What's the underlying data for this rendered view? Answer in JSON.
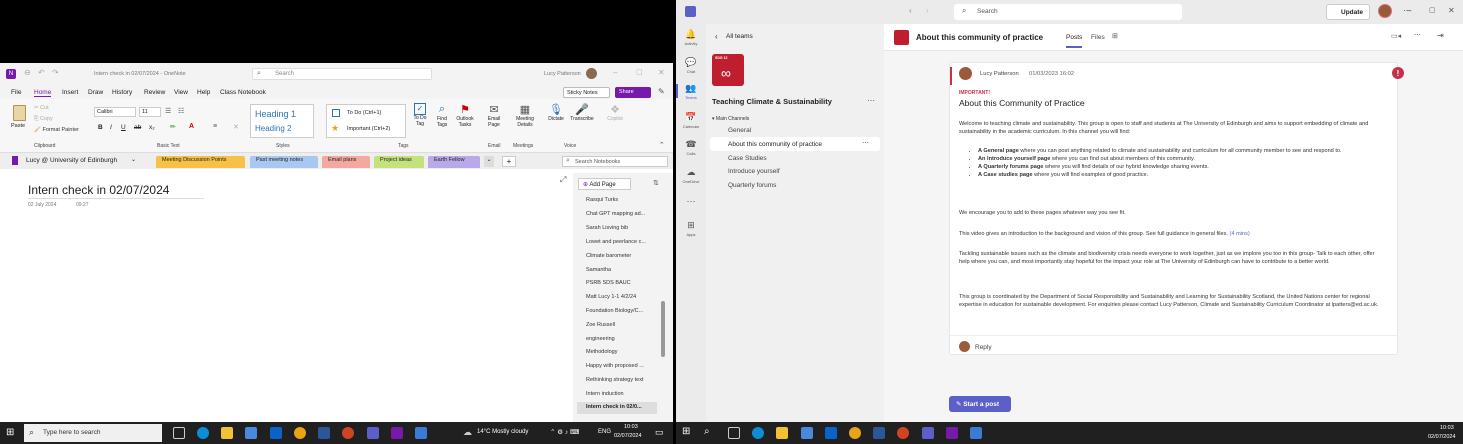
{
  "onenote": {
    "title": "Intern check in 02/07/2024 - OneNote",
    "search_placeholder": "Search",
    "user": "Lucy Patterson",
    "menu": [
      "File",
      "Home",
      "Insert",
      "Draw",
      "History",
      "Review",
      "View",
      "Help",
      "Class Notebook"
    ],
    "sticky_notes": "Sticky Notes",
    "share": "Share",
    "font_name": "Calibri",
    "font_size": "11",
    "clipboard": {
      "paste": "Paste",
      "cut": "Cut",
      "copy": "Copy",
      "format_painter": "Format Painter"
    },
    "styles": {
      "h1": "Heading 1",
      "h2": "Heading 2"
    },
    "tags": {
      "todo": "To Do (Ctrl+1)",
      "important": "Important (Ctrl+2)"
    },
    "buttons": {
      "todo_tag": "To Do Tag",
      "find_tags": "Find Tags",
      "outlook_tasks": "Outlook Tasks",
      "email_page": "Email Page",
      "meeting_details": "Meeting Details",
      "dictate": "Dictate",
      "transcribe": "Transcribe",
      "copilot": "Copilot"
    },
    "groups": [
      "Clipboard",
      "Basic Text",
      "Styles",
      "Tags",
      "Email",
      "Meetings",
      "Voice"
    ],
    "notebook": "Lucy @ University of Edinburgh",
    "sections": [
      "Meeting Discussion Points",
      "Past meeting notes",
      "Email plans",
      "Project ideas",
      "Earth Fellow"
    ],
    "search_notebooks": "Search Notebooks",
    "add_page": "Add Page",
    "page_title": "Intern check in 02/07/2024",
    "page_date": "02 July 2024",
    "page_time": "09:27",
    "pages": [
      "Rasqui Turks",
      "Chat GPT mapping ad...",
      "Sarah Lisving bib",
      "Lowet and peerlance c...",
      "Climate barometer",
      "Samantha",
      "PSRB SDS BAUC",
      "Matt Lucy 1-1 4/2/24",
      "Foundation Biology/C...",
      "Zoe Russell",
      "engineering",
      "Methodology",
      "Happy with proposed ...",
      "Rethinking strategy text",
      "Intern induction",
      "Intern check in 02/0..."
    ]
  },
  "taskbar_left": {
    "search": "Type here to search",
    "weather": "14°C  Mostly cloudy",
    "lang": "ENG",
    "time": "10:03",
    "date": "02/07/2024"
  },
  "taskbar_right": {
    "time": "10:03",
    "date": "02/07/2024"
  },
  "teams": {
    "search": "Search",
    "update": "Update",
    "rail": [
      "Activity",
      "Chat",
      "Teams",
      "Calendar",
      "Calls",
      "OneDrive",
      "Apps"
    ],
    "all_teams": "All teams",
    "team_name": "Teaching Climate & Sustainability",
    "team_badge": "SDG 12",
    "main_channels": "Main Channels",
    "channels": [
      "General",
      "About this community of practice",
      "Case Studies",
      "Introduce yourself",
      "Quarterly forums"
    ],
    "header_title": "About this community of practice",
    "tabs": [
      "Posts",
      "Files"
    ],
    "post": {
      "author": "Lucy Patterson",
      "timestamp": "01/03/2023 16:02",
      "important": "IMPORTANT!",
      "title": "About this Community of Practice",
      "p1": "Welcome to teaching climate and sustainability. This group is open to staff and students at The University of Edinburgh and aims to support embedding of climate and sustainability in the academic curriculum. In this channel you will find:",
      "bullets": [
        {
          "bold": "A General page",
          "rest": " where you can post anything related to climate and sustainability and curriculum for all community member to see and respond to."
        },
        {
          "bold": "An Introduce yourself page",
          "rest": " where you can find out about members of this community."
        },
        {
          "bold": "A Quarterly forums page",
          "rest": " where you will find details of our hybrid knowledge sharing events."
        },
        {
          "bold": "A Case studies page",
          "rest": " where you will find examples of good practice."
        }
      ],
      "p2": "We encourage you to add to these pages whatever way you see fit.",
      "p3": "This video gives an introduction to the background and vision of this group. See full guidance in general files.",
      "p3_link": "(4 mins)",
      "p4": "Tackling sustainable issues such as the climate and biodiversity crisis needs everyone to work together, just as we implore you too in this group- Talk to each other, offer help where you can, and most importantly stay hopeful for the impact your role at The University of Edinburgh can have to contribute to a better world.",
      "p5": "This group is coordinated by the Department of Social Responsibility and Sustainability and Learning for Sustainability Scotland, the United Nations center for regional expertise in education for sustainable development. For enquiries please contact Lucy Patterson, Climate and Sustainability Curriculum Coordinator at lpatters@ed.ac.uk.",
      "reply": "Reply"
    },
    "start_post": "Start a post"
  },
  "colors": {
    "teams_purple": "#5b5fc7",
    "onenote_purple": "#7719aa",
    "important_red": "#c4314b"
  }
}
